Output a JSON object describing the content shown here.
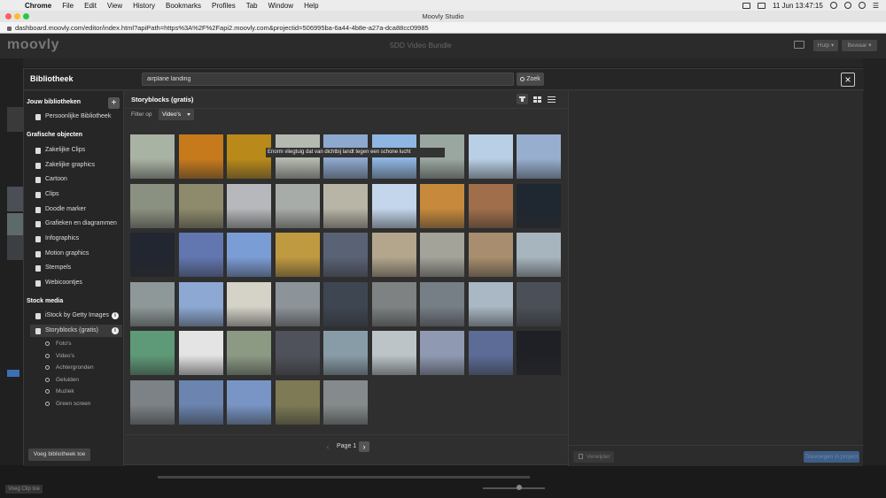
{
  "menubar": {
    "app": "Chrome",
    "items": [
      "File",
      "Edit",
      "View",
      "History",
      "Bookmarks",
      "Profiles",
      "Tab",
      "Window",
      "Help"
    ],
    "clock": "11 Jun  13:47:15"
  },
  "browser": {
    "window_title": "Moovly Studio",
    "url": "dashboard.moovly.com/editor/index.html?apiPath=https%3A%2F%2Fapi2.moovly.com&projectid=506995ba-6a44-4b8e-a27a-dca88cc09985"
  },
  "app": {
    "logo": "moovly",
    "project_title": "5DD Video Bundle",
    "help_label": "Hulp ▾",
    "save_label": "Bewaar ▾",
    "add_clip_label": "Voeg Clip toe"
  },
  "library": {
    "title": "Bibliotheek",
    "search": {
      "value": "airplane landing",
      "button": "Zoek"
    },
    "sections": {
      "own": {
        "title": "Jouw bibliotheken",
        "items": [
          "Persoonlijke Bibliotheek"
        ]
      },
      "graphics": {
        "title": "Grafische objecten",
        "items": [
          "Zakelijke Clips",
          "Zakelijke graphics",
          "Cartoon",
          "Clips",
          "Doodle marker",
          "Grafieken en diagrammen",
          "Infographics",
          "Motion graphics",
          "Stempels",
          "Webicoontjes"
        ]
      },
      "stock": {
        "title": "Stock media",
        "items": [
          "iStock by Getty Images",
          "Storyblocks (gratis)"
        ],
        "sub_items": [
          "Foto's",
          "Video's",
          "Achtergronden",
          "Geluiden",
          "Muziek",
          "Green screen"
        ]
      }
    },
    "add_library_button": "Voeg bibliotheek toe",
    "provider_title": "Storyblocks (gratis)",
    "filter": {
      "label": "Filter op",
      "value": "Video's"
    },
    "tooltip": "Enorm vliegtuig dat van dichtbij landt tegen een schone lucht",
    "pagination": {
      "label": "Page 1",
      "prev": "‹",
      "next": "›"
    },
    "delete_button": "Verwijder",
    "add_to_project_button": "Toevoegen in project",
    "thumbnail_colors": [
      [
        "#a9b3a4",
        "#c77a1c",
        "#b98a1a",
        "#b5bab0",
        "#8ea9cf",
        "#8fb6e2",
        "#9aa7a0",
        "#b9cfe6",
        "#97aecf"
      ],
      [
        "#8b9181",
        "#8e8a6c",
        "#b7b8bc",
        "#a8aca8",
        "#b8b4a6",
        "#c4d6ec",
        "#c78a3c",
        "#a06e4a",
        "#1f2730"
      ],
      [
        "#222630",
        "#6276b0",
        "#7b9dd6",
        "#c09a40",
        "#5a6275",
        "#b4a68c",
        "#a3a39a",
        "#a88e6e",
        "#a7b5bf"
      ],
      [
        "#8e9898",
        "#8da9d3",
        "#d5d3c8",
        "#8d9499",
        "#3e4652",
        "#7e8282",
        "#767e86",
        "#a9b8c4",
        "#4b5058"
      ],
      [
        "#5e9a78",
        "#e4e4e4",
        "#8c9a84",
        "#4f525a",
        "#889ca8",
        "#bcc4c8",
        "#8f9ab2",
        "#5c6c96",
        "#1e2026"
      ],
      [
        "#7c8286",
        "#6b84b0",
        "#7895c6",
        "#7d7a55",
        "#858b8c"
      ]
    ]
  }
}
